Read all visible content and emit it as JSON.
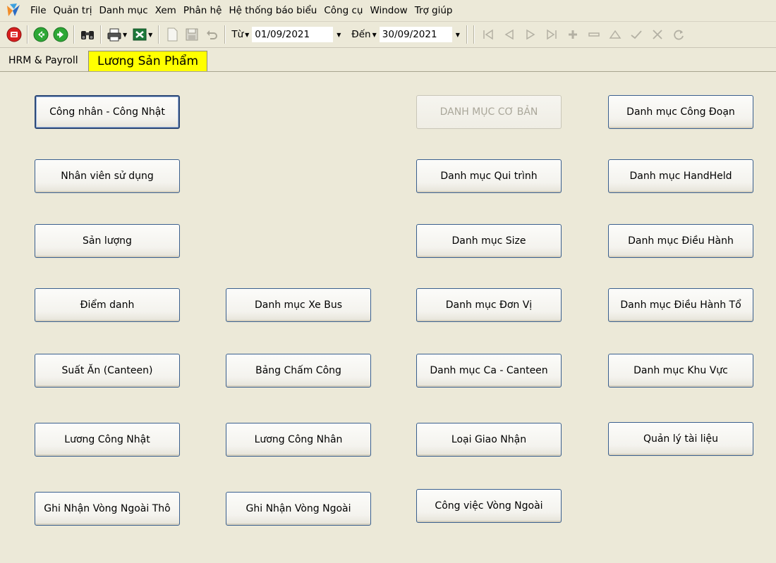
{
  "menu": [
    "File",
    "Quản trị",
    "Danh mục",
    "Xem",
    "Phân hệ",
    "Hệ thống báo biểu",
    "Công cụ",
    "Window",
    "Trợ giúp"
  ],
  "toolbar": {
    "from_label": "Từ",
    "from_date": "01/09/2021",
    "to_label": "Đến",
    "to_date": "30/09/2021"
  },
  "tabs": [
    "HRM & Payroll",
    "Lương Sản Phẩm"
  ],
  "buttons": {
    "c1": [
      "Công nhân - Công Nhật",
      "Nhân viên sử dụng",
      "Sản lượng",
      "Điểm danh",
      "Suất Ăn (Canteen)",
      "Lương Công Nhật",
      "Ghi Nhận Vòng Ngoài Thô"
    ],
    "c2": [
      "Danh mục Xe Bus",
      "Bảng Chấm Công",
      "Lương Công Nhân",
      "Ghi Nhận Vòng Ngoài"
    ],
    "c3": [
      "DANH MỤC CƠ BẢN",
      "Danh mục Qui trình",
      "Danh mục Size",
      "Danh mục Đơn Vị",
      "Danh mục Ca - Canteen",
      "Loại Giao Nhận",
      "Công việc Vòng Ngoài"
    ],
    "c4": [
      "Danh mục Công Đoạn",
      "Danh mục HandHeld",
      "Danh mục Điều Hành",
      "Danh mục Điều Hành Tổ",
      "Danh mục Khu Vực",
      "Quản lý tài liệu"
    ]
  },
  "colors": {
    "tab_active_bg": "#ffff00",
    "button_border": "#3a5f8e",
    "background": "#ece9d8"
  }
}
